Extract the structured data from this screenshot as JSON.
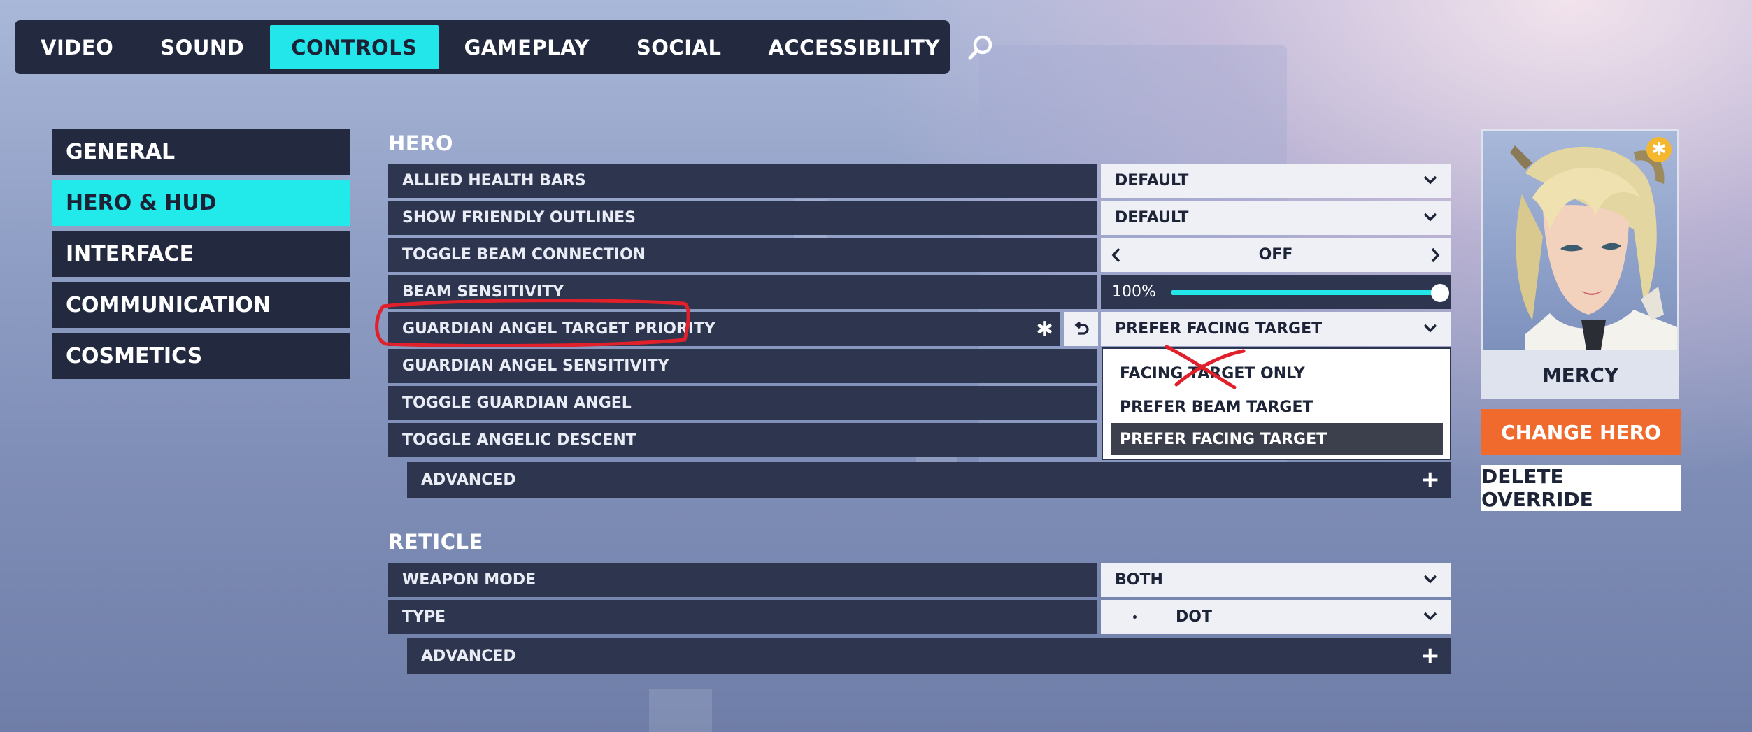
{
  "nav": {
    "tabs": [
      {
        "label": "VIDEO"
      },
      {
        "label": "SOUND"
      },
      {
        "label": "CONTROLS"
      },
      {
        "label": "GAMEPLAY"
      },
      {
        "label": "SOCIAL"
      },
      {
        "label": "ACCESSIBILITY"
      }
    ],
    "active_tab": "CONTROLS",
    "search_icon": "search-icon"
  },
  "sidebar": {
    "items": [
      {
        "label": "GENERAL"
      },
      {
        "label": "HERO & HUD"
      },
      {
        "label": "INTERFACE"
      },
      {
        "label": "COMMUNICATION"
      },
      {
        "label": "COSMETICS"
      }
    ],
    "active": "HERO & HUD"
  },
  "hero_section": {
    "title": "HERO",
    "rows": [
      {
        "label": "ALLIED HEALTH BARS",
        "value": "DEFAULT"
      },
      {
        "label": "SHOW FRIENDLY OUTLINES",
        "value": "DEFAULT"
      },
      {
        "label": "TOGGLE BEAM CONNECTION",
        "value": "OFF"
      },
      {
        "label": "BEAM SENSITIVITY",
        "value": "100%"
      },
      {
        "label": "GUARDIAN ANGEL TARGET PRIORITY",
        "value": "PREFER FACING TARGET",
        "modified_mark": "✱"
      },
      {
        "label": "GUARDIAN ANGEL SENSITIVITY"
      },
      {
        "label": "TOGGLE GUARDIAN ANGEL"
      },
      {
        "label": "TOGGLE ANGELIC DESCENT"
      }
    ],
    "advanced_label": "ADVANCED",
    "beam_sensitivity_level": 1.0
  },
  "dropdown": {
    "options": [
      {
        "label": "FACING TARGET ONLY"
      },
      {
        "label": "PREFER BEAM TARGET"
      },
      {
        "label": "PREFER FACING TARGET"
      }
    ],
    "selected": "PREFER FACING TARGET"
  },
  "reticle_section": {
    "title": "RETICLE",
    "rows": [
      {
        "label": "WEAPON MODE",
        "value": "BOTH"
      },
      {
        "label": "TYPE",
        "value": "DOT"
      }
    ],
    "advanced_label": "ADVANCED"
  },
  "hero_card": {
    "name": "MERCY",
    "change_hero_label": "CHANGE HERO",
    "delete_override_label": "DELETE OVERRIDE",
    "badge_icon": "asterisk-icon"
  },
  "colors": {
    "accent": "#22e6ea",
    "panel": "#2d354f",
    "nav": "#232a40",
    "change_hero": "#f06a2e",
    "annotation": "#e0202a"
  }
}
